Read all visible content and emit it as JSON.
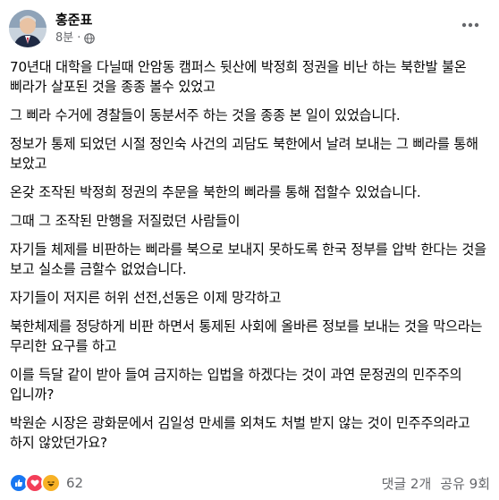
{
  "post": {
    "author": "홍준표",
    "time": "8분",
    "separator": "·",
    "privacy_icon": "globe-icon",
    "more_icon": "more-horizontal-icon",
    "paragraphs": [
      "70년대 대학을 다닐때 안암동 캠퍼스 뒷산에 박정희 정권을 비난 하는 북한발 불온 삐라가 살포된 것을 종종 볼수 있었고",
      "그 삐라 수거에 경찰들이 동분서주 하는 것을 종종 본 일이 있었습니다.",
      "정보가 통제 되었던 시절 정인숙 사건의 괴담도 북한에서 날려 보내는 그 삐라를 통해 보았고",
      "온갖 조작된 박정희 정권의 추문을 북한의 삐라를 통해 접할수 있었습니다.",
      "그때  그 조작된 만행을 저질렀던 사람들이",
      "자기들 체제를 비판하는 삐라를 북으로 보내지 못하도록 한국 정부를 압박 한다는 것을 보고 실소를 금할수 없었습니다.",
      "자기들이 저지른 허위 선전,선동은 이제 망각하고",
      "북한체제를 정당하게 비판 하면서 통제된 사회에 올바른 정보를 보내는 것을 막으라는 무리한 요구를 하고",
      "이를 득달 같이 받아 들여 금지하는 입법을 하겠다는 것이 과연 문정권의  민주주의 입니까?",
      "박원순 시장은 광화문에서 김일성 만세를 외쳐도 처벌 받지 않는 것이 민주주의라고 하지 않았던가요?"
    ]
  },
  "footer": {
    "reaction_icons": [
      "like-icon",
      "love-icon",
      "haha-icon"
    ],
    "reaction_count": "62",
    "comments": "댓글 2개",
    "shares": "공유 9회"
  },
  "colors": {
    "text": "#050505",
    "secondary": "#65676b",
    "like": "#1877f2",
    "love": "#f33e58",
    "haha": "#f7b125"
  }
}
